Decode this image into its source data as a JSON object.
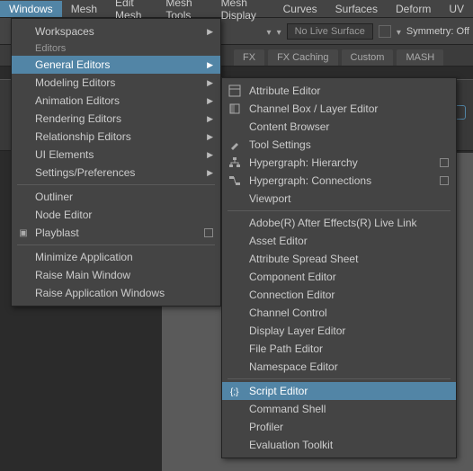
{
  "menubar": [
    "Windows",
    "Mesh",
    "Edit Mesh",
    "Mesh Tools",
    "Mesh Display",
    "Curves",
    "Surfaces",
    "Deform",
    "UV"
  ],
  "toolbar": {
    "live_surface": "No Live Surface",
    "symmetry": "Symmetry: Off"
  },
  "tabs": [
    "FX",
    "FX Caching",
    "Custom",
    "MASH"
  ],
  "menu1": {
    "section1": "Workspaces",
    "section2": "Editors",
    "items": [
      "General Editors",
      "Modeling Editors",
      "Animation Editors",
      "Rendering Editors",
      "Relationship Editors",
      "UI Elements",
      "Settings/Preferences"
    ],
    "group2": [
      "Outliner",
      "Node Editor",
      "Playblast"
    ],
    "group3": [
      "Minimize Application",
      "Raise Main Window",
      "Raise Application Windows"
    ]
  },
  "menu2": {
    "g1": [
      "Attribute Editor",
      "Channel Box / Layer Editor",
      "Content Browser",
      "Tool Settings",
      "Hypergraph: Hierarchy",
      "Hypergraph: Connections",
      "Viewport"
    ],
    "g2": [
      "Adobe(R) After Effects(R) Live Link",
      "Asset Editor",
      "Attribute Spread Sheet",
      "Component Editor",
      "Connection Editor",
      "Channel Control",
      "Display Layer Editor",
      "File Path Editor",
      "Namespace Editor"
    ],
    "g3": [
      "Script Editor",
      "Command Shell",
      "Profiler",
      "Evaluation Toolkit"
    ]
  }
}
